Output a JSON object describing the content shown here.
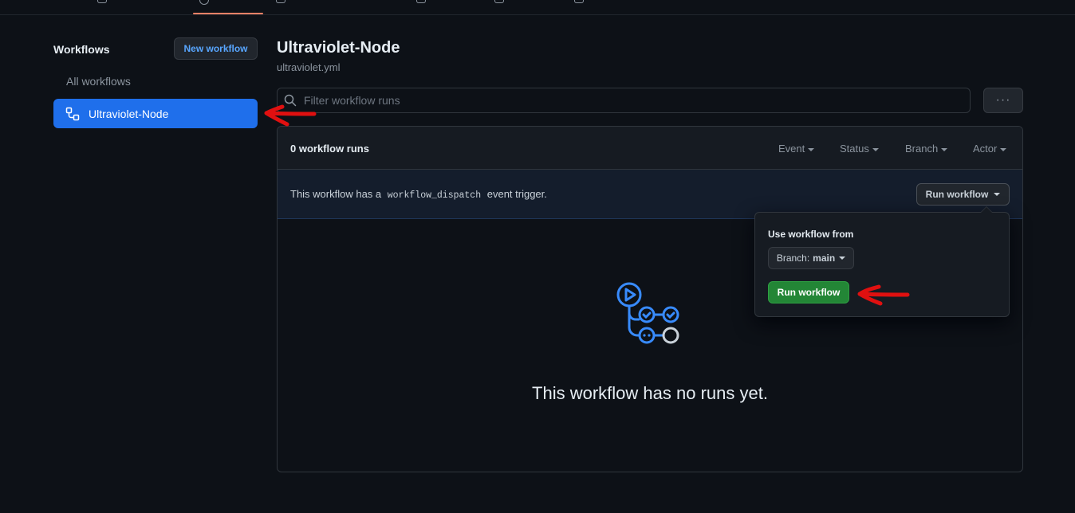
{
  "sidebar": {
    "title": "Workflows",
    "new_workflow_label": "New workflow",
    "all_workflows_label": "All workflows",
    "selected_workflow_label": "Ultraviolet-Node"
  },
  "main": {
    "title": "Ultraviolet-Node",
    "filename": "ultraviolet.yml",
    "filter_placeholder": "Filter workflow runs",
    "more_label": "···"
  },
  "runs": {
    "count_label": "0 workflow runs",
    "filters": [
      "Event",
      "Status",
      "Branch",
      "Actor"
    ]
  },
  "dispatch": {
    "text_before": "This workflow has a",
    "code": "workflow_dispatch",
    "text_after": "event trigger.",
    "run_button_label": "Run workflow"
  },
  "popup": {
    "label": "Use workflow from",
    "branch_prefix": "Branch:",
    "branch_name": "main",
    "run_button_label": "Run workflow"
  },
  "empty_state": {
    "message": "This workflow has no runs yet."
  },
  "colors": {
    "background": "#0d1117",
    "accent_blue": "#1f6feb",
    "link_blue": "#58a6ff",
    "green_button": "#238636",
    "annotation_red": "#e01010"
  },
  "icons": [
    "search-icon",
    "workflow-icon",
    "caret-down-icon",
    "kebab-icon",
    "actions-empty-icon"
  ]
}
